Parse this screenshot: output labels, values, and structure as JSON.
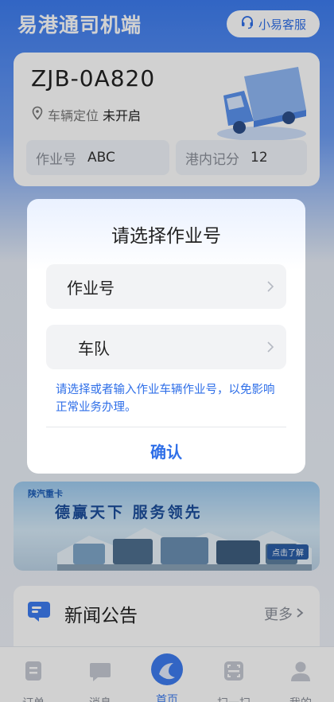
{
  "header": {
    "app_title": "易港通司机端",
    "service_label": "小易客服"
  },
  "vehicle": {
    "plate": "ZJB-0A820",
    "location_label": "车辆定位",
    "location_status": "未开启",
    "job_label": "作业号",
    "job_value": "ABC",
    "score_label": "港内记分",
    "score_value": "12"
  },
  "banner": {
    "logo_text": "陕汽重卡",
    "slogan": "德赢天下 服务领先",
    "cta": "点击了解"
  },
  "news": {
    "title": "新闻公告",
    "more_label": "更多"
  },
  "tabbar": {
    "items": [
      {
        "label": "订单"
      },
      {
        "label": "消息"
      },
      {
        "label": "首页"
      },
      {
        "label": "扫一扫"
      },
      {
        "label": "我的"
      }
    ]
  },
  "dialog": {
    "title": "请选择作业号",
    "job_field_label": "作业号",
    "team_field_label": "车队",
    "hint": "请选择或者输入作业车辆作业号，以免影响正常业务办理。",
    "confirm_label": "确认"
  },
  "colors": {
    "primary": "#3d7cf0",
    "link_blue": "#2f6fe8",
    "overlay": "rgba(0,0,0,0.18)"
  },
  "icons": [
    "headset-icon",
    "location-pin-icon",
    "truck-illustration",
    "megaphone-icon",
    "chevron-right-icon",
    "order-icon",
    "message-icon",
    "home-icon",
    "scan-icon",
    "profile-icon"
  ]
}
